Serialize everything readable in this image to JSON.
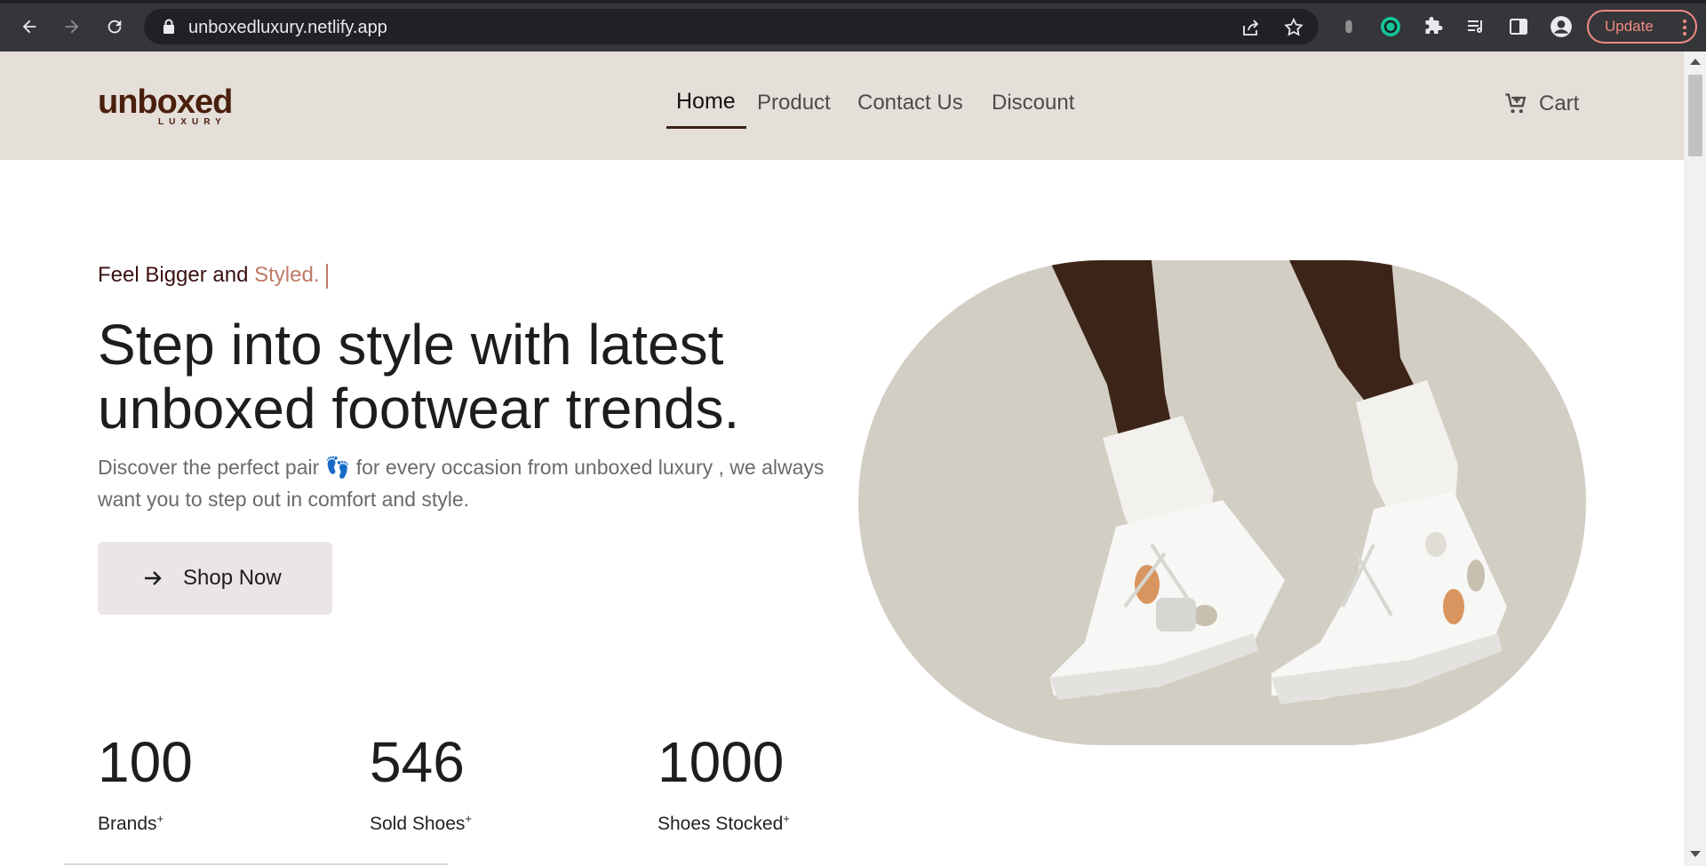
{
  "browser": {
    "url": "unboxedluxury.netlify.app",
    "update_label": "Update"
  },
  "site": {
    "logo_text": "unboxed",
    "logo_sub": "LUXURY",
    "nav": [
      {
        "label": "Home",
        "active": true
      },
      {
        "label": "Product",
        "active": false
      },
      {
        "label": "Contact Us",
        "active": false
      },
      {
        "label": "Discount",
        "active": false
      }
    ],
    "cart_label": "Cart"
  },
  "hero": {
    "tagline_prefix": "Feel Bigger and ",
    "tagline_accent": "Styled.",
    "headline": "Step into style with latest unboxed footwear trends.",
    "description_part1": "Discover the perfect pair",
    "description_emoji": "👣",
    "description_part2": "for every occasion from unboxed luxury , we always want you to step out in comfort and style.",
    "cta_label": "Shop Now"
  },
  "stats": [
    {
      "value": "100",
      "label": "Brands"
    },
    {
      "value": "546",
      "label": "Sold Shoes"
    },
    {
      "value": "1000",
      "label": "Shoes Stocked"
    }
  ],
  "colors": {
    "header_bg": "#e5dfd9",
    "accent": "#c07a66",
    "brand": "#4a1f0c",
    "hero_bg": "#d3cec4"
  }
}
